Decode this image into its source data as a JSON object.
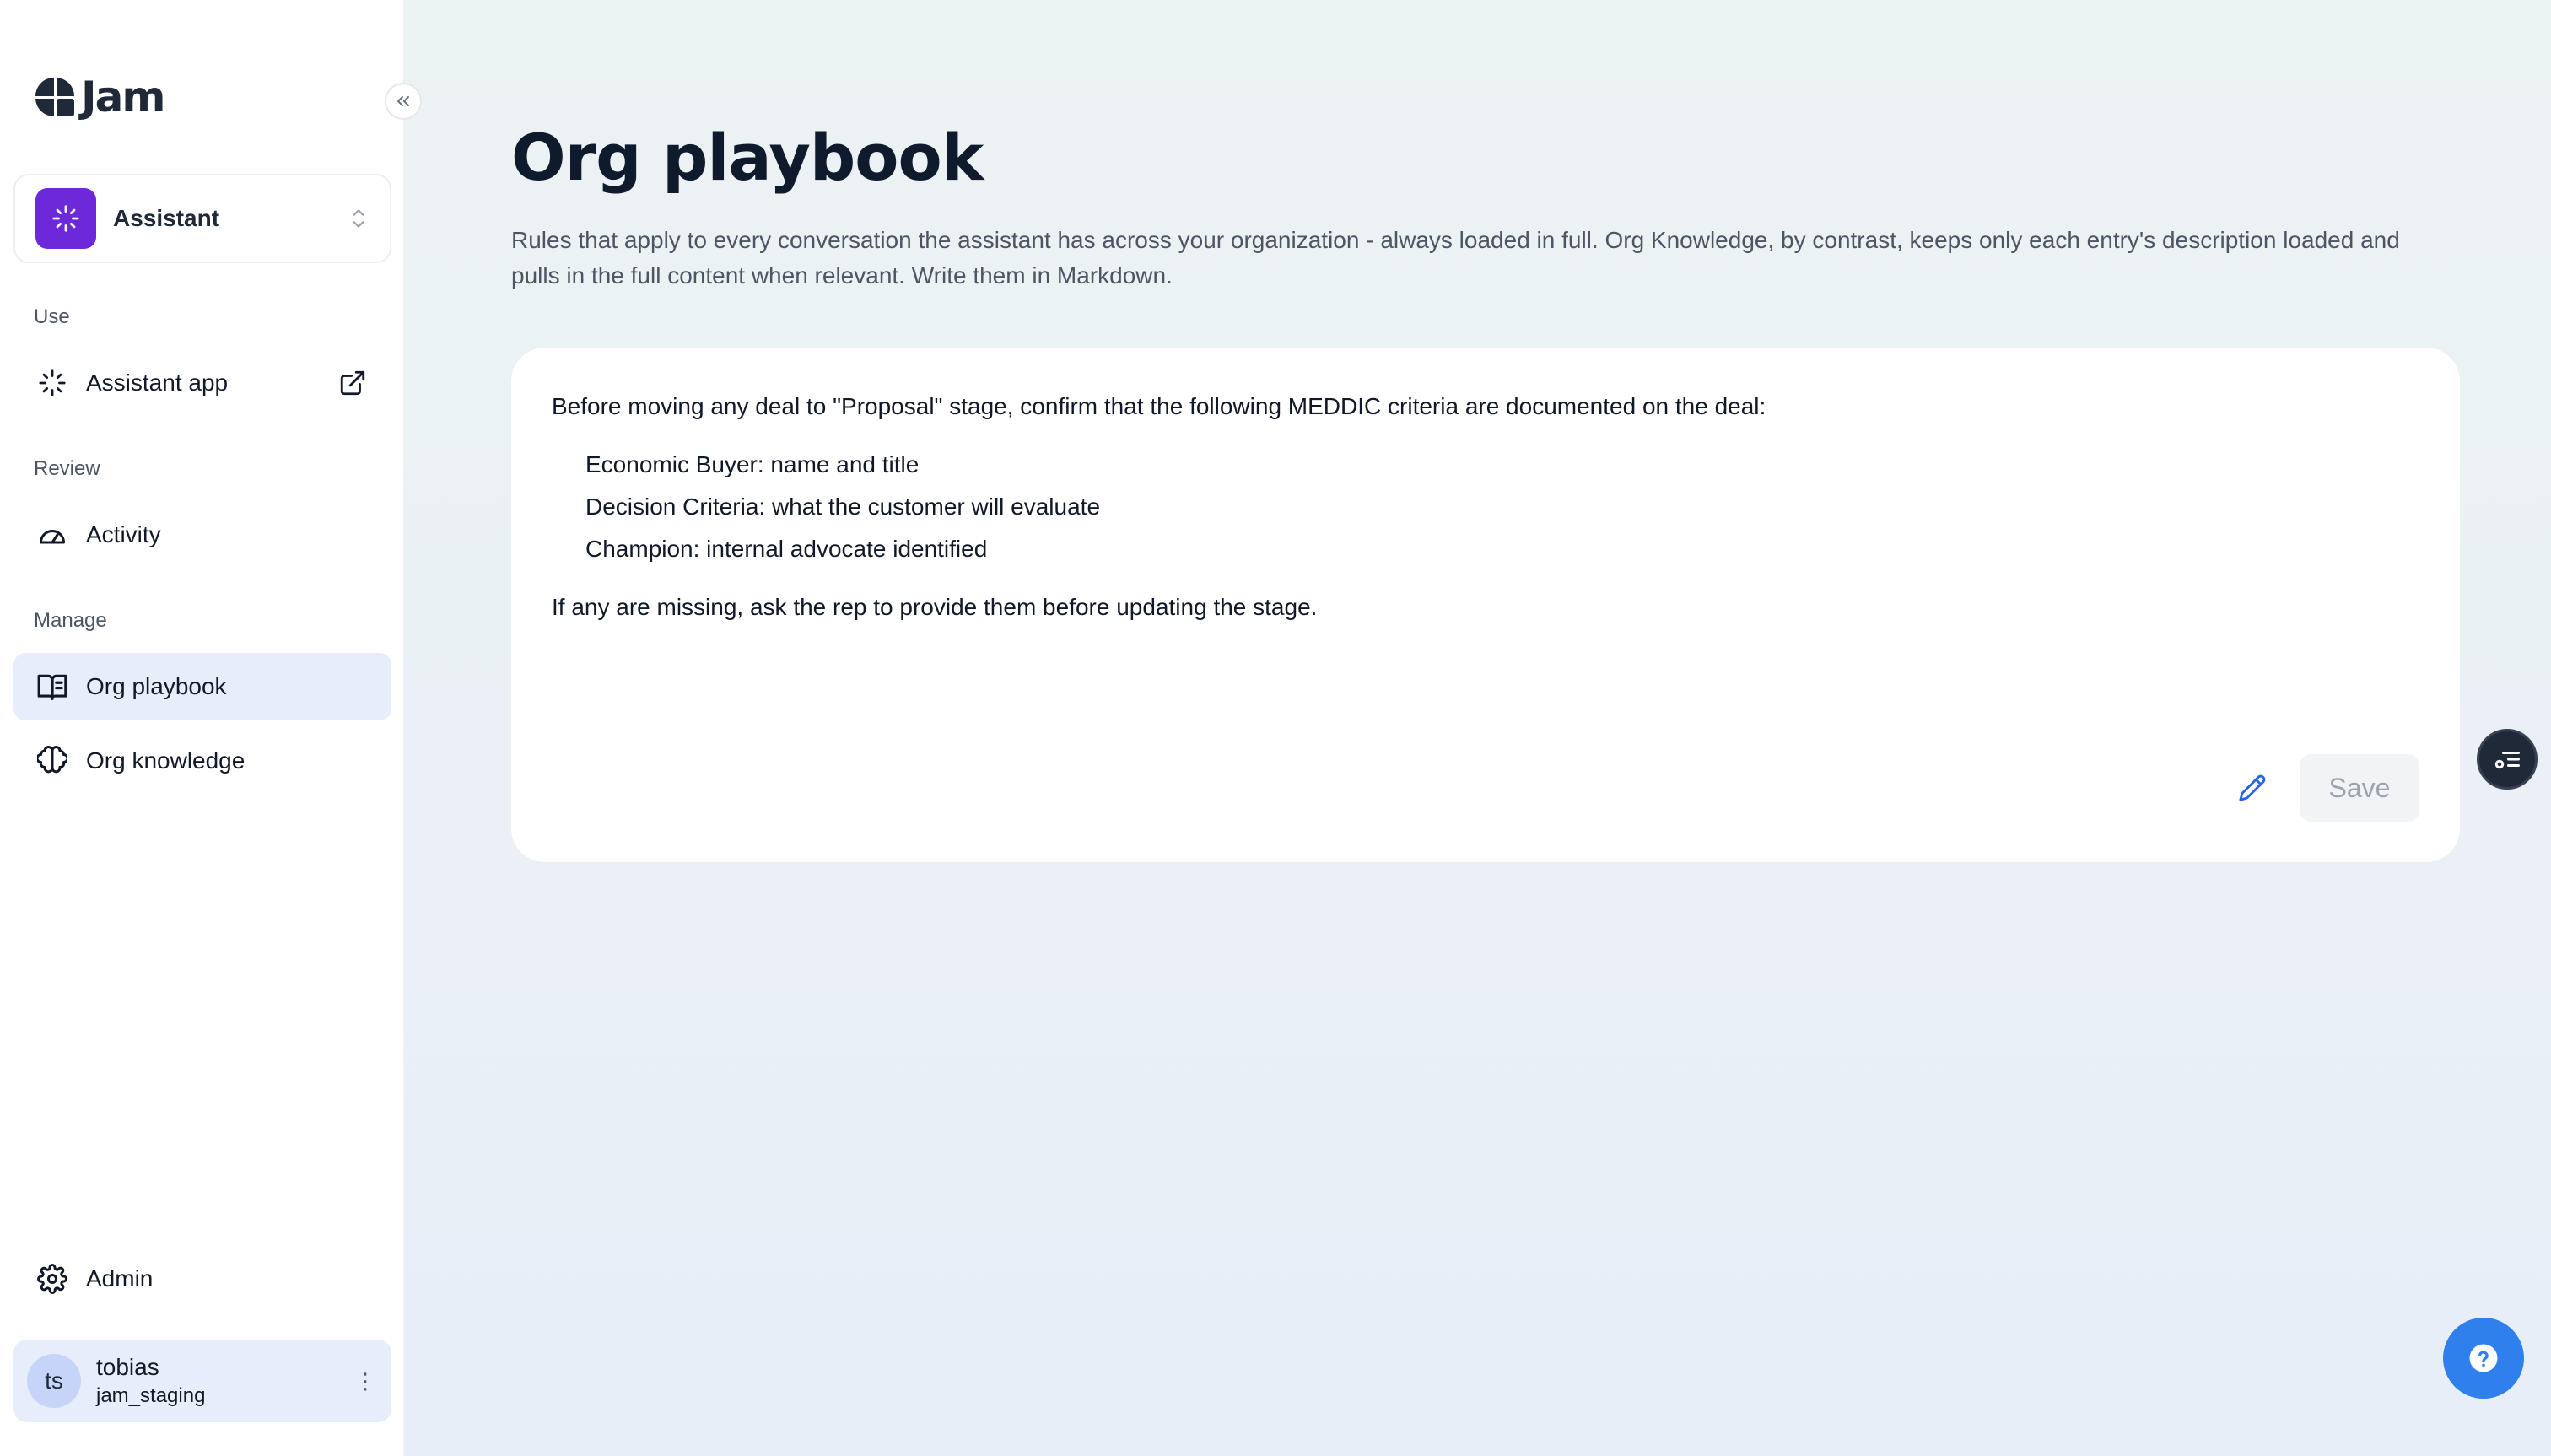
{
  "brand": {
    "name": "Jam"
  },
  "app_switcher": {
    "label": "Assistant"
  },
  "sidebar": {
    "sections": [
      {
        "label": "Use"
      },
      {
        "label": "Review"
      },
      {
        "label": "Manage"
      }
    ],
    "items": [
      {
        "label": "Assistant app",
        "icon": "sparkle-icon"
      },
      {
        "label": "Activity",
        "icon": "gauge-icon"
      },
      {
        "label": "Org playbook",
        "icon": "book-icon",
        "active": true
      },
      {
        "label": "Org knowledge",
        "icon": "brain-icon"
      },
      {
        "label": "Admin",
        "icon": "gear-icon"
      }
    ]
  },
  "user": {
    "initials": "ts",
    "name": "tobias",
    "org": "jam_staging"
  },
  "page": {
    "title": "Org playbook",
    "description": "Rules that apply to every conversation the assistant has across your organization - always loaded in full. Org Knowledge, by contrast, keeps only each entry's description loaded and pulls in the full content when relevant. Write them in Markdown."
  },
  "editor": {
    "intro": "Before moving any deal to \"Proposal\" stage, confirm that the following MEDDIC criteria are documented on the deal:",
    "bullets": [
      "Economic Buyer: name and title",
      "Decision Criteria: what the customer will evaluate",
      "Champion: internal advocate identified"
    ],
    "outro": "If any are missing, ask the rep to provide them before updating the stage.",
    "save_label": "Save"
  },
  "colors": {
    "accent": "#6d28d9",
    "active_bg": "#e8edfb",
    "fab": "#2f80ed"
  }
}
